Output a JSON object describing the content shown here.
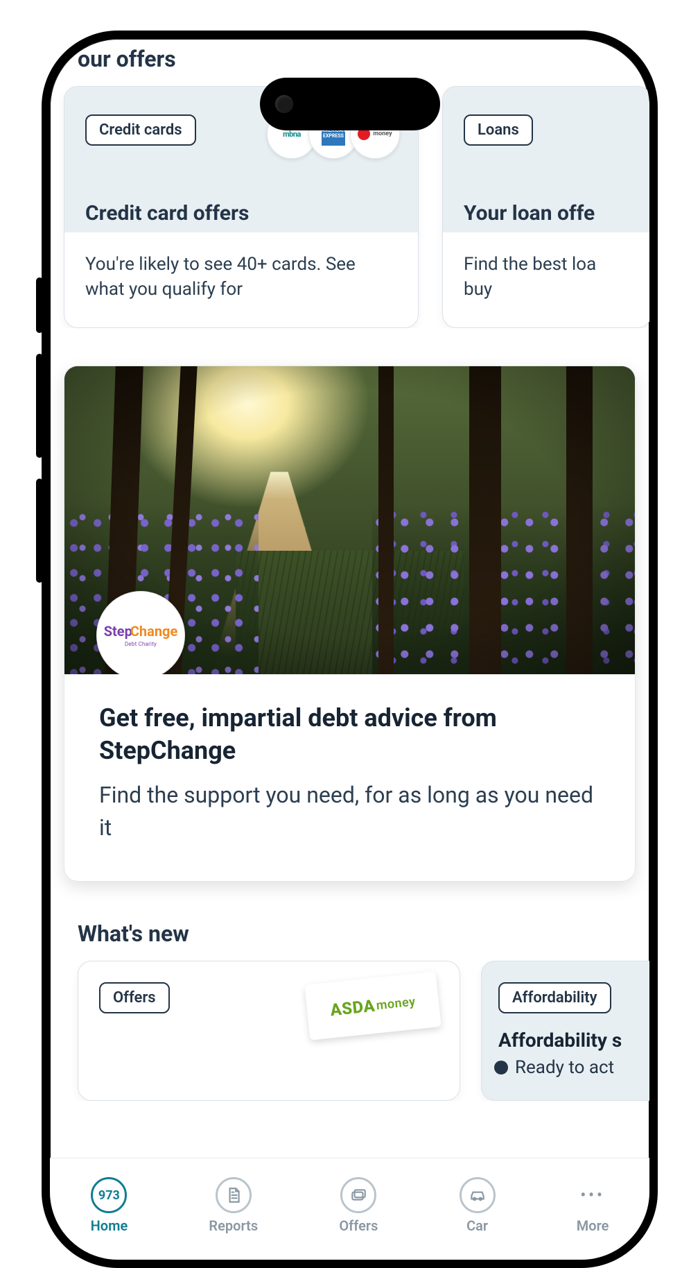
{
  "sections": {
    "offers_title": "our offers",
    "whats_new_title": "What's new"
  },
  "offer_cards": {
    "credit": {
      "tag": "Credit cards",
      "title": "Credit card offers",
      "body": "You're likely to see 40+ cards. See what you qualify for",
      "logos": [
        "mbna",
        "american-express",
        "virgin-money"
      ]
    },
    "loans": {
      "tag": "Loans",
      "title": "Your loan offe",
      "body": "Find the best loa\nbuy"
    }
  },
  "hero": {
    "badge_line1a": "Step",
    "badge_line1b": "Change",
    "badge_sub": "Debt Charity",
    "title": "Get free, impartial debt advice from StepChange",
    "body": "Find the support you need, for as long as you need it"
  },
  "whats_new": {
    "offers": {
      "tag": "Offers",
      "logo_text_a": "ASDA",
      "logo_text_b": "money"
    },
    "afford": {
      "tag": "Affordability",
      "title": "Affordability s",
      "sub": "Ready to act"
    }
  },
  "tabs": {
    "home": {
      "label": "Home",
      "badge": "973"
    },
    "reports": {
      "label": "Reports"
    },
    "offers": {
      "label": "Offers"
    },
    "car": {
      "label": "Car"
    },
    "more": {
      "label": "More"
    }
  }
}
